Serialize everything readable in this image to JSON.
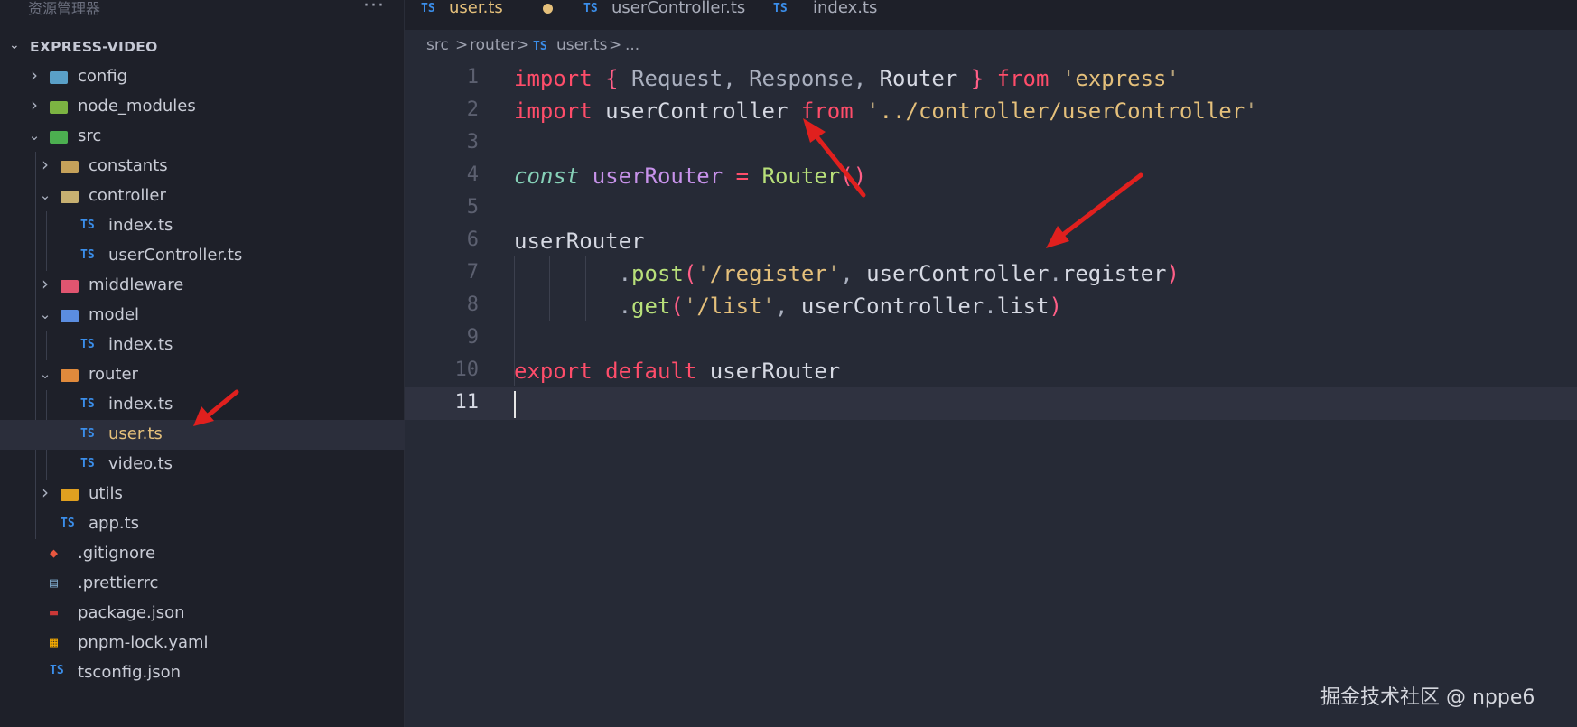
{
  "explorer": {
    "title": "资源管理器",
    "more": "···",
    "root_chevron": "⌄",
    "root_label": "EXPRESS-VIDEO",
    "items": [
      {
        "label": "config",
        "kind": "folder",
        "expanded": false,
        "depth": 0,
        "icon": "config-folder-icon"
      },
      {
        "label": "node_modules",
        "kind": "folder",
        "expanded": false,
        "depth": 0,
        "icon": "node-folder-icon"
      },
      {
        "label": "src",
        "kind": "folder",
        "expanded": true,
        "depth": 0,
        "icon": "src-folder-icon"
      },
      {
        "label": "constants",
        "kind": "folder",
        "expanded": false,
        "depth": 1,
        "icon": "folder-icon"
      },
      {
        "label": "controller",
        "kind": "folder",
        "expanded": true,
        "depth": 1,
        "icon": "controller-folder-icon"
      },
      {
        "label": "index.ts",
        "kind": "file",
        "depth": 2,
        "icon": "ts-file-icon"
      },
      {
        "label": "userController.ts",
        "kind": "file",
        "depth": 2,
        "icon": "ts-file-icon"
      },
      {
        "label": "middleware",
        "kind": "folder",
        "expanded": false,
        "depth": 1,
        "icon": "middleware-folder-icon"
      },
      {
        "label": "model",
        "kind": "folder",
        "expanded": true,
        "depth": 1,
        "icon": "model-folder-icon"
      },
      {
        "label": "index.ts",
        "kind": "file",
        "depth": 2,
        "icon": "ts-file-icon"
      },
      {
        "label": "router",
        "kind": "folder",
        "expanded": true,
        "depth": 1,
        "icon": "router-folder-icon"
      },
      {
        "label": "index.ts",
        "kind": "file",
        "depth": 2,
        "icon": "ts-file-icon"
      },
      {
        "label": "user.ts",
        "kind": "file",
        "depth": 2,
        "icon": "ts-file-icon",
        "selected": true
      },
      {
        "label": "video.ts",
        "kind": "file",
        "depth": 2,
        "icon": "ts-file-icon"
      },
      {
        "label": "utils",
        "kind": "folder",
        "expanded": false,
        "depth": 1,
        "icon": "utils-folder-icon"
      },
      {
        "label": "app.ts",
        "kind": "file",
        "depth": 1,
        "icon": "ts-file-icon"
      },
      {
        "label": ".gitignore",
        "kind": "file",
        "depth": 0,
        "icon": "git-icon"
      },
      {
        "label": ".prettierrc",
        "kind": "file",
        "depth": 0,
        "icon": "prettier-icon"
      },
      {
        "label": "package.json",
        "kind": "file",
        "depth": 0,
        "icon": "npm-icon"
      },
      {
        "label": "pnpm-lock.yaml",
        "kind": "file",
        "depth": 0,
        "icon": "pnpm-icon"
      },
      {
        "label": "tsconfig.json",
        "kind": "file",
        "depth": 0,
        "icon": "tsconfig-icon"
      }
    ]
  },
  "tabs": [
    {
      "icon_text": "TS",
      "label": "user.ts",
      "active": true,
      "modified": true
    },
    {
      "icon_text": "TS",
      "label": "userController.ts",
      "active": false,
      "modified": false
    },
    {
      "icon_text": "TS",
      "label": "index.ts",
      "active": false,
      "modified": false
    }
  ],
  "breadcrumb": {
    "parts": [
      "src",
      "router"
    ],
    "file_icon": "TS",
    "file": "user.ts",
    "ellipsis": "...",
    "separator": ">"
  },
  "editor": {
    "line_numbers": [
      "1",
      "2",
      "3",
      "4",
      "5",
      "6",
      "7",
      "8",
      "9",
      "10",
      "11"
    ],
    "current_line": 11,
    "lines": [
      [
        {
          "t": "import",
          "c": "kw"
        },
        {
          "t": " "
        },
        {
          "t": "{",
          "c": "paren"
        },
        {
          "t": " Request, Response, ",
          "c": "pun"
        },
        {
          "t": "Router"
        },
        {
          "t": " "
        },
        {
          "t": "}",
          "c": "paren"
        },
        {
          "t": " "
        },
        {
          "t": "from",
          "c": "kw"
        },
        {
          "t": " "
        },
        {
          "t": "'",
          "c": "q"
        },
        {
          "t": "express",
          "c": "str"
        },
        {
          "t": "'",
          "c": "q"
        }
      ],
      [
        {
          "t": "import",
          "c": "kw"
        },
        {
          "t": " userController "
        },
        {
          "t": "from",
          "c": "kw"
        },
        {
          "t": " "
        },
        {
          "t": "'",
          "c": "q"
        },
        {
          "t": "../controller/userController",
          "c": "str"
        },
        {
          "t": "'",
          "c": "q"
        }
      ],
      [],
      [
        {
          "t": "const",
          "c": "kwi"
        },
        {
          "t": " "
        },
        {
          "t": "userRouter",
          "c": "var"
        },
        {
          "t": " "
        },
        {
          "t": "=",
          "c": "kw"
        },
        {
          "t": " "
        },
        {
          "t": "Router",
          "c": "fn"
        },
        {
          "t": "()",
          "c": "paren"
        }
      ],
      [],
      [
        {
          "t": "userRouter"
        }
      ],
      [
        {
          "t": "        "
        },
        {
          "t": ".",
          "c": "pun"
        },
        {
          "t": "post",
          "c": "mth"
        },
        {
          "t": "(",
          "c": "paren"
        },
        {
          "t": "'",
          "c": "q"
        },
        {
          "t": "/register",
          "c": "str"
        },
        {
          "t": "'",
          "c": "q"
        },
        {
          "t": ", ",
          "c": "pun"
        },
        {
          "t": "userController"
        },
        {
          "t": ".",
          "c": "pun"
        },
        {
          "t": "register"
        },
        {
          "t": ")",
          "c": "paren"
        }
      ],
      [
        {
          "t": "        "
        },
        {
          "t": ".",
          "c": "pun"
        },
        {
          "t": "get",
          "c": "mth"
        },
        {
          "t": "(",
          "c": "paren"
        },
        {
          "t": "'",
          "c": "q"
        },
        {
          "t": "/list",
          "c": "str"
        },
        {
          "t": "'",
          "c": "q"
        },
        {
          "t": ", ",
          "c": "pun"
        },
        {
          "t": "userController"
        },
        {
          "t": ".",
          "c": "pun"
        },
        {
          "t": "list"
        },
        {
          "t": ")",
          "c": "paren"
        }
      ],
      [],
      [
        {
          "t": "export",
          "c": "kw"
        },
        {
          "t": " "
        },
        {
          "t": "default",
          "c": "kw"
        },
        {
          "t": " userRouter"
        }
      ],
      []
    ]
  },
  "watermark": "掘金技术社区 @ nppe6",
  "colors": {
    "annotation_arrow": "#e0201e",
    "ts_blue": "#3b8eea",
    "modified_dot": "#e5c07b"
  }
}
